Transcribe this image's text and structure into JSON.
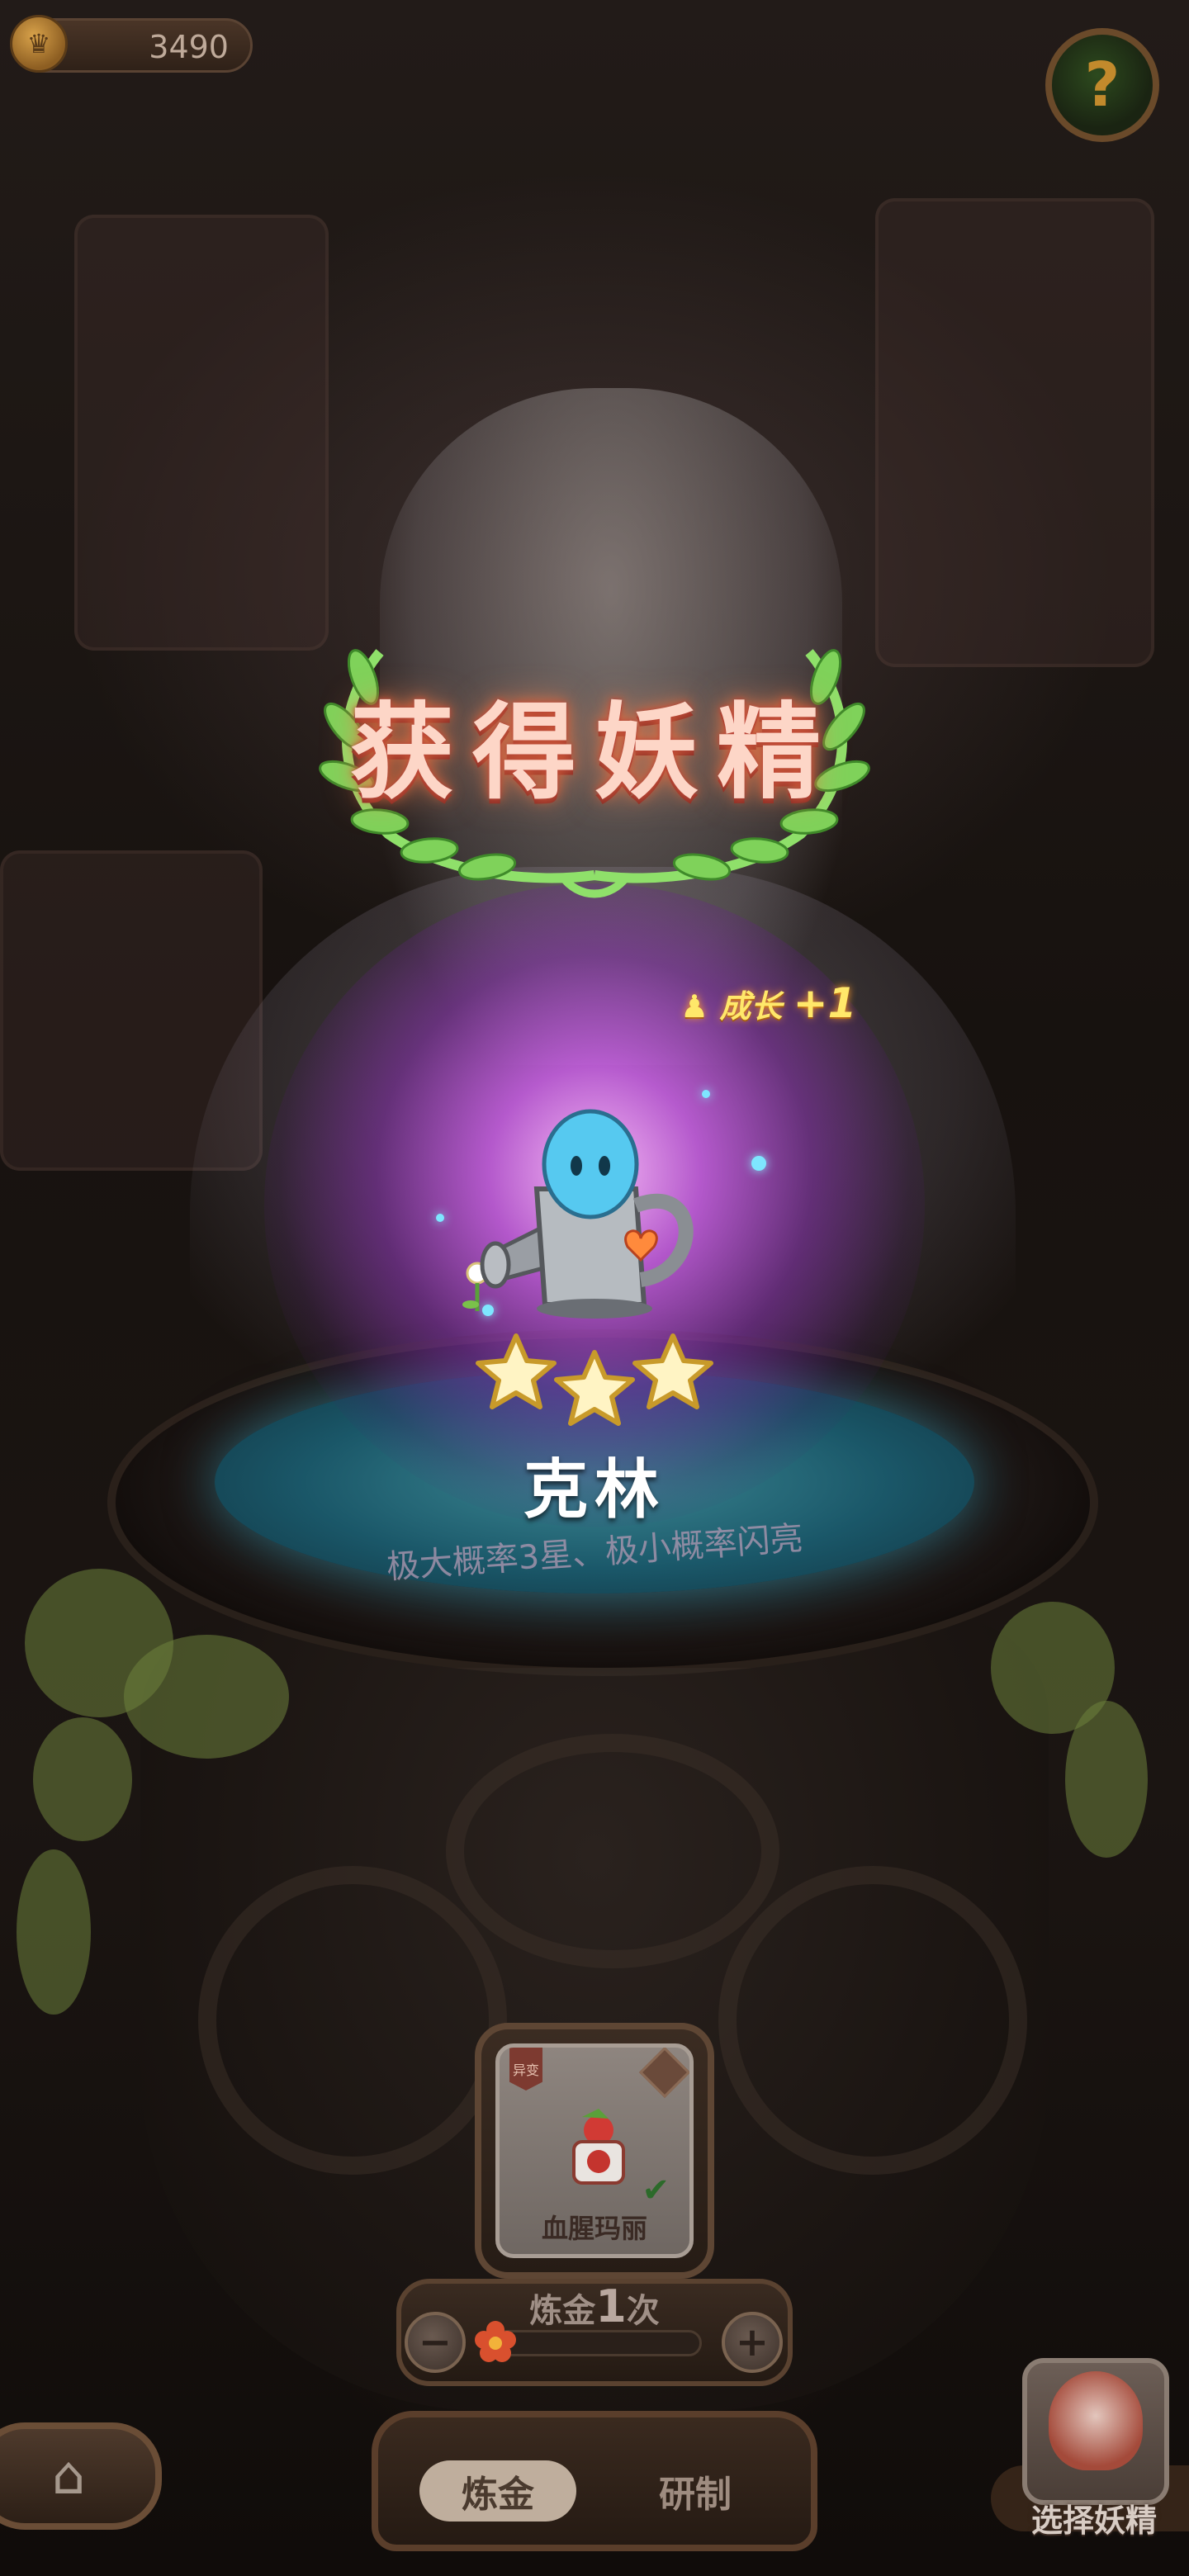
{
  "top_bar": {
    "coins": "3490",
    "coin_icon": "coin-icon",
    "help_icon": "question-sprout-icon"
  },
  "reward": {
    "banner_title": "获得妖精",
    "growth_text": "成长",
    "growth_bonus": "+1",
    "fairy_name": "克林",
    "fairy_sprite": "watering-can-fairy",
    "star_count": 3,
    "hint": "极大概率3星、极小概率闪亮"
  },
  "recipe_card": {
    "tag": "异变",
    "label": "血腥玛丽"
  },
  "alchemy": {
    "label_prefix": "炼金",
    "count": "1",
    "label_suffix": "次",
    "minus_icon": "minus-icon",
    "plus_icon": "plus-icon"
  },
  "tabs": {
    "active": "炼金",
    "other": "研制"
  },
  "home": {
    "icon": "home-icon"
  },
  "select_fairy": {
    "label": "选择妖精"
  },
  "colors": {
    "glow": "#c65ce6",
    "title": "#fdd6c7",
    "growth": "#ffe86a",
    "pool": "#3aa0b5"
  }
}
